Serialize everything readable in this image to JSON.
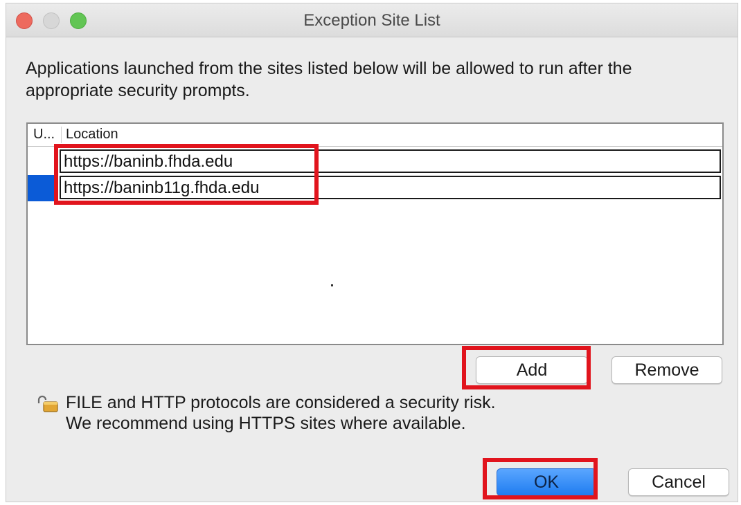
{
  "window": {
    "title": "Exception Site List"
  },
  "intro_text": "Applications launched from the sites listed below will be allowed to run after the appropriate security prompts.",
  "table": {
    "columns": [
      "U...",
      "Location"
    ],
    "rows": [
      {
        "location": "https://baninb.fhda.edu"
      },
      {
        "location": "https://baninb11g.fhda.edu"
      }
    ]
  },
  "buttons": {
    "add": "Add",
    "remove": "Remove",
    "ok": "OK",
    "cancel": "Cancel"
  },
  "warning": {
    "icon": "open-lock-icon",
    "line1": "FILE and HTTP protocols are considered a security risk.",
    "line2": "We recommend using HTTPS sites where available."
  },
  "colors": {
    "highlight": "#e1141d",
    "selection": "#0b5bd7",
    "ok_button": "#1f7cf0"
  }
}
